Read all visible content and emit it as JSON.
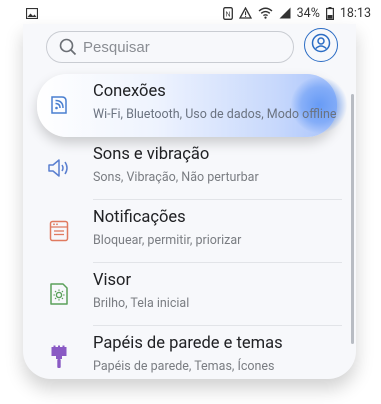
{
  "status_bar": {
    "battery_percent": "34%",
    "time": "18:13",
    "icons": [
      "gallery-icon",
      "nfc-icon",
      "alert-icon",
      "wifi-icon",
      "signal-icon",
      "battery-icon"
    ]
  },
  "search": {
    "placeholder": "Pesquisar"
  },
  "settings": [
    {
      "title": "Conexões",
      "subtitle": "Wi-Fi, Bluetooth, Uso de dados, Modo offline",
      "icon": "connections-icon"
    },
    {
      "title": "Sons e vibração",
      "subtitle": "Sons, Vibração, Não perturbar",
      "icon": "speaker-icon"
    },
    {
      "title": "Notificações",
      "subtitle": "Bloquear, permitir, priorizar",
      "icon": "notifications-icon"
    },
    {
      "title": "Visor",
      "subtitle": "Brilho, Tela inicial",
      "icon": "display-icon"
    },
    {
      "title": "Papéis de parede e temas",
      "subtitle": "Papéis de parede, Temas, Ícones",
      "icon": "brush-icon"
    }
  ],
  "colors": {
    "accent": "#2b6cc4",
    "highlight_gradient_end": "#a8c3fb",
    "connections_icon": "#4a7fd0",
    "sound_icon": "#5a7fd0",
    "notifications_icon": "#e07a5f",
    "display_icon": "#5aa05a",
    "brush_icon": "#8a5ac4"
  }
}
